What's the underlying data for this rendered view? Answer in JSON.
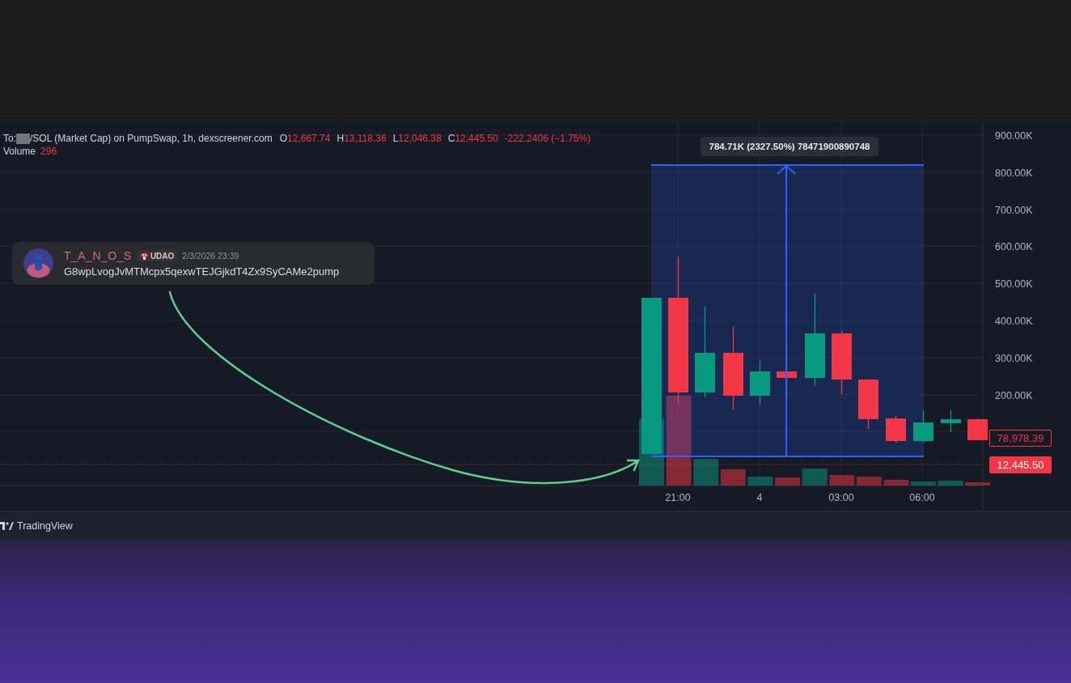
{
  "legend": {
    "symbol_prefix": "To:",
    "symbol_rest": "/SOL (Market Cap) on PumpSwap, 1h, dexscreener.com",
    "ohlc": [
      {
        "key": "O",
        "value": "12,667.74"
      },
      {
        "key": "H",
        "value": "13,118.36"
      },
      {
        "key": "L",
        "value": "12,046.38"
      },
      {
        "key": "C",
        "value": "12,445.50"
      }
    ],
    "change": "-222.2406 (−1.75%)",
    "volume_label": "Volume",
    "volume_value": "296"
  },
  "message": {
    "author": "T_A_N_O_S",
    "badge": "UDAO",
    "time": "2/3/2026 23:39",
    "text": "G8wpLvogJvMTMcpx5qexwTEJGjkdT4Zx9SyCAMe2pump"
  },
  "measure": {
    "label": "784.71K (2327.50%) 78471900890748"
  },
  "price_axis": [
    "900.00K",
    "800.00K",
    "700.00K",
    "600.00K",
    "500.00K",
    "400.00K",
    "300.00K",
    "200.00K"
  ],
  "price_labels": [
    {
      "text": "78,978.39",
      "kind": "outlined"
    },
    {
      "text": "12,445.50",
      "kind": "filled"
    }
  ],
  "time_axis": [
    "21:00",
    "4",
    "03:00",
    "06:00"
  ],
  "footer": {
    "brand": "TradingView"
  }
}
